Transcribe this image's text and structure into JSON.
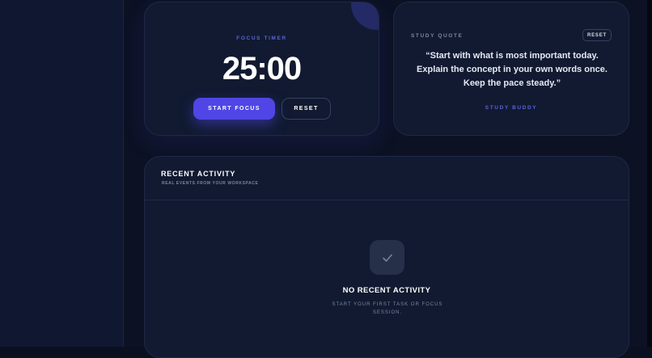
{
  "focus_timer": {
    "label": "FOCUS TIMER",
    "time": "25:00",
    "start_label": "START FOCUS",
    "reset_label": "RESET"
  },
  "study_quote": {
    "label": "STUDY QUOTE",
    "reset_label": "RESET",
    "quote": "“Start with what is most important today. Explain the concept in your own words once. Keep the pace steady.”",
    "author": "STUDY BUDDY"
  },
  "recent_activity": {
    "title": "RECENT ACTIVITY",
    "subtitle": "REAL EVENTS FROM YOUR WORKSPACE",
    "empty_icon": "check-icon",
    "empty_title": "NO RECENT ACTIVITY",
    "empty_subtitle": "START YOUR FIRST TASK OR FOCUS SESSION."
  },
  "colors": {
    "accent": "#4f46e5",
    "accent_text": "#5a63d6",
    "background": "#0c1224",
    "card": "#111a31"
  }
}
